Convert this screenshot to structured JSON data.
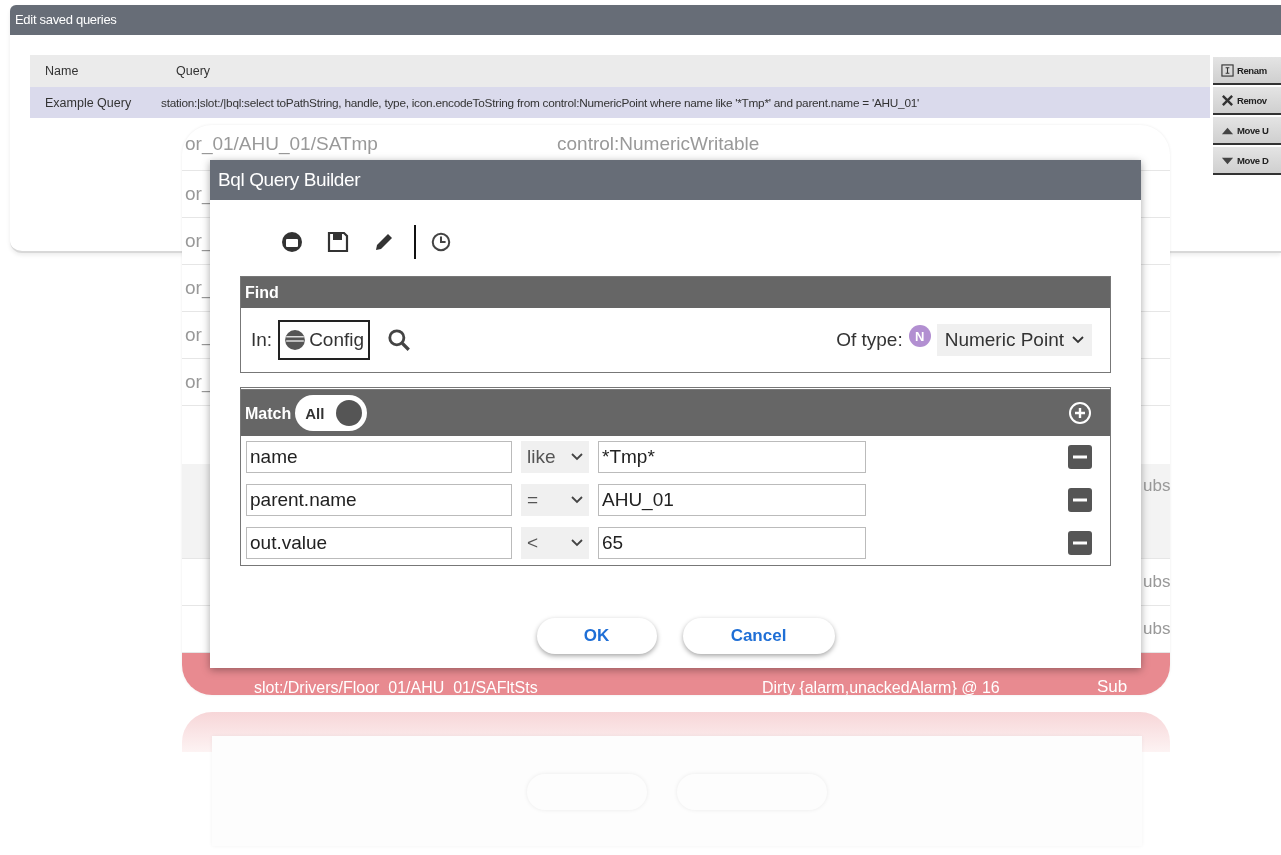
{
  "window": {
    "title": "Edit saved queries"
  },
  "queries_table": {
    "columns": [
      "Name",
      "Query"
    ],
    "rows": [
      {
        "name": "Example Query",
        "query": "station:|slot:/|bql:select toPathString, handle, type, icon.encodeToString from control:NumericPoint where name like '*Tmp*' and parent.name = 'AHU_01'",
        "selected": true
      }
    ]
  },
  "side_buttons": [
    {
      "kind": "rename",
      "label": "Renam"
    },
    {
      "kind": "remove",
      "label": "Remov"
    },
    {
      "kind": "up",
      "label": "Move U"
    },
    {
      "kind": "down",
      "label": "Move D"
    }
  ],
  "results": {
    "rows": [
      {
        "column_1": "or_01/AHU_01/SATmp",
        "column_2": "control:NumericWritable",
        "highlighted": false,
        "alarm": false
      },
      {
        "column_1": "or_",
        "highlighted": false,
        "alarm": false
      },
      {
        "column_1": "or_",
        "highlighted": false,
        "alarm": false
      },
      {
        "column_1": "or_",
        "highlighted": false,
        "alarm": false
      },
      {
        "column_1": "or_",
        "highlighted": false,
        "alarm": false
      },
      {
        "column_1": "or_",
        "highlighted": false,
        "alarm": false
      },
      {
        "column_3": "ubs",
        "highlighted": true,
        "alarm": false
      },
      {
        "column_3": "ubs",
        "highlighted": false,
        "alarm": false
      },
      {
        "column_3": "ubs",
        "highlighted": false,
        "alarm": false
      },
      {
        "column_1": "slot:/Drivers/Floor_01/AHU_01/SAFltSts",
        "column_2": "Dirty {alarm,unackedAlarm} @ 16",
        "column_3": "Sub",
        "highlighted": false,
        "alarm": true
      }
    ]
  },
  "dialog": {
    "title": "Bql Query Builder",
    "toolbar": [
      {
        "kind": "open"
      },
      {
        "kind": "save"
      },
      {
        "kind": "edit"
      },
      {
        "kind": "separator"
      },
      {
        "kind": "history"
      }
    ],
    "find": {
      "title": "Find",
      "in_label": "In:",
      "scope": "Config",
      "type_label": "Of type:",
      "type_badge": "N",
      "type": "Numeric Point"
    },
    "match": {
      "title": "Match",
      "toggle": {
        "text": "All",
        "on": true
      },
      "conditions": [
        {
          "field": "name",
          "operator": "like",
          "value": "*Tmp*"
        },
        {
          "field": "parent.name",
          "operator": "=",
          "value": "AHU_01"
        },
        {
          "field": "out.value",
          "operator": "<",
          "value": "65"
        }
      ]
    },
    "buttons": [
      "OK",
      "Cancel"
    ]
  }
}
